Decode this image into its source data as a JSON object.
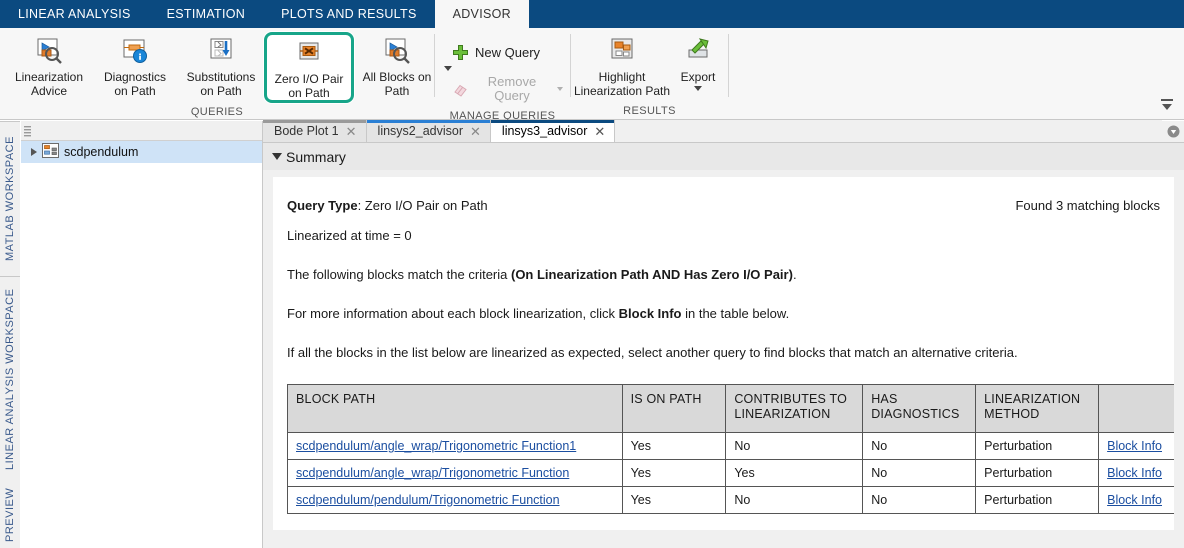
{
  "ribbon": {
    "tabs": [
      {
        "label": "LINEAR ANALYSIS",
        "active": false
      },
      {
        "label": "ESTIMATION",
        "active": false
      },
      {
        "label": "PLOTS AND RESULTS",
        "active": false
      },
      {
        "label": "ADVISOR",
        "active": true
      }
    ],
    "groups": {
      "queries": {
        "label": "QUERIES",
        "buttons": [
          {
            "line1": "Linearization",
            "line2": "Advice",
            "icon": "linearization-advice-icon",
            "highlighted": false
          },
          {
            "line1": "Diagnostics",
            "line2": "on Path",
            "icon": "diagnostics-on-path-icon",
            "highlighted": false
          },
          {
            "line1": "Substitutions",
            "line2": "on Path",
            "icon": "substitutions-on-path-icon",
            "highlighted": false
          },
          {
            "line1": "Zero I/O Pair",
            "line2": "on Path",
            "icon": "zero-io-pair-on-path-icon",
            "highlighted": true
          },
          {
            "line1": "All Blocks on",
            "line2": "Path",
            "icon": "all-blocks-on-path-icon",
            "highlighted": false
          }
        ],
        "overflow_icon": "chevron-down-icon"
      },
      "manage_queries": {
        "label": "MANAGE QUERIES",
        "new_query": "New Query",
        "new_query_icon": "plus-green-icon",
        "remove_query": "Remove Query",
        "remove_query_icon": "eraser-icon",
        "remove_query_disabled": true,
        "remove_query_dropdown_icon": "chevron-down-icon"
      },
      "results": {
        "label": "RESULTS",
        "buttons": [
          {
            "line1": "Highlight",
            "line2": "Linearization Path",
            "icon": "highlight-linearization-path-icon",
            "has_dropdown": false
          },
          {
            "line1": "Export",
            "line2": "",
            "icon": "export-icon",
            "has_dropdown": true
          }
        ]
      }
    },
    "collapse_icon": "collapse-ribbon-icon",
    "highlight_color": "#17a589",
    "tabbar_color": "#0b4a80"
  },
  "left_vertical_tabs": [
    {
      "label": "MATLAB WORKSPACE"
    },
    {
      "label": "LINEAR ANALYSIS WORKSPACE"
    },
    {
      "label": "PREVIEW"
    }
  ],
  "tree": {
    "grip_icon": "drag-grip-icon",
    "items": [
      {
        "label": "scdpendulum",
        "icon": "simulink-model-icon",
        "expander_icon": "chevron-right-icon",
        "selected": true
      }
    ]
  },
  "doctabs": {
    "tabs": [
      {
        "label": "Bode Plot 1",
        "active": false,
        "accent": "#9a9a9a",
        "close_icon": "close-icon"
      },
      {
        "label": "linsys2_advisor",
        "active": false,
        "accent": "#2a7fd4",
        "close_icon": "close-icon"
      },
      {
        "label": "linsys3_advisor",
        "active": true,
        "accent": "#0b4a80",
        "close_icon": "close-icon"
      }
    ],
    "menu_icon": "tab-overflow-menu-icon"
  },
  "summary": {
    "toggle_icon": "triangle-down-icon",
    "title": "Summary",
    "query_type_label": "Query Type",
    "query_type_value": "Zero I/O Pair on Path",
    "found_text": "Found 3 matching blocks",
    "linearized_at": "Linearized at time = 0",
    "para1_a": "The following blocks match the criteria ",
    "para1_b": "(On Linearization Path AND Has Zero I/O Pair)",
    "para1_c": ".",
    "para2_a": "For more information about each block linearization, click ",
    "para2_b": "Block Info",
    "para2_c": " in the table below.",
    "para3": "If all the blocks in the list below are linearized as expected, select another query to find blocks that match an alternative criteria."
  },
  "table": {
    "headers": [
      "Block Path",
      "Is on Path",
      "Contributes to Linearization",
      "Has Diagnostics",
      "Linearization Method",
      ""
    ],
    "rows": [
      {
        "block_path": "scdpendulum/angle_wrap/Trigonometric Function1",
        "is_on_path": "Yes",
        "contributes": "No",
        "has_diagnostics": "No",
        "method": "Perturbation",
        "info": "Block Info"
      },
      {
        "block_path": "scdpendulum/angle_wrap/Trigonometric Function",
        "is_on_path": "Yes",
        "contributes": "Yes",
        "has_diagnostics": "No",
        "method": "Perturbation",
        "info": "Block Info"
      },
      {
        "block_path": "scdpendulum/pendulum/Trigonometric Function",
        "is_on_path": "Yes",
        "contributes": "No",
        "has_diagnostics": "No",
        "method": "Perturbation",
        "info": "Block Info"
      }
    ],
    "link_color": "#1b4ea0"
  }
}
